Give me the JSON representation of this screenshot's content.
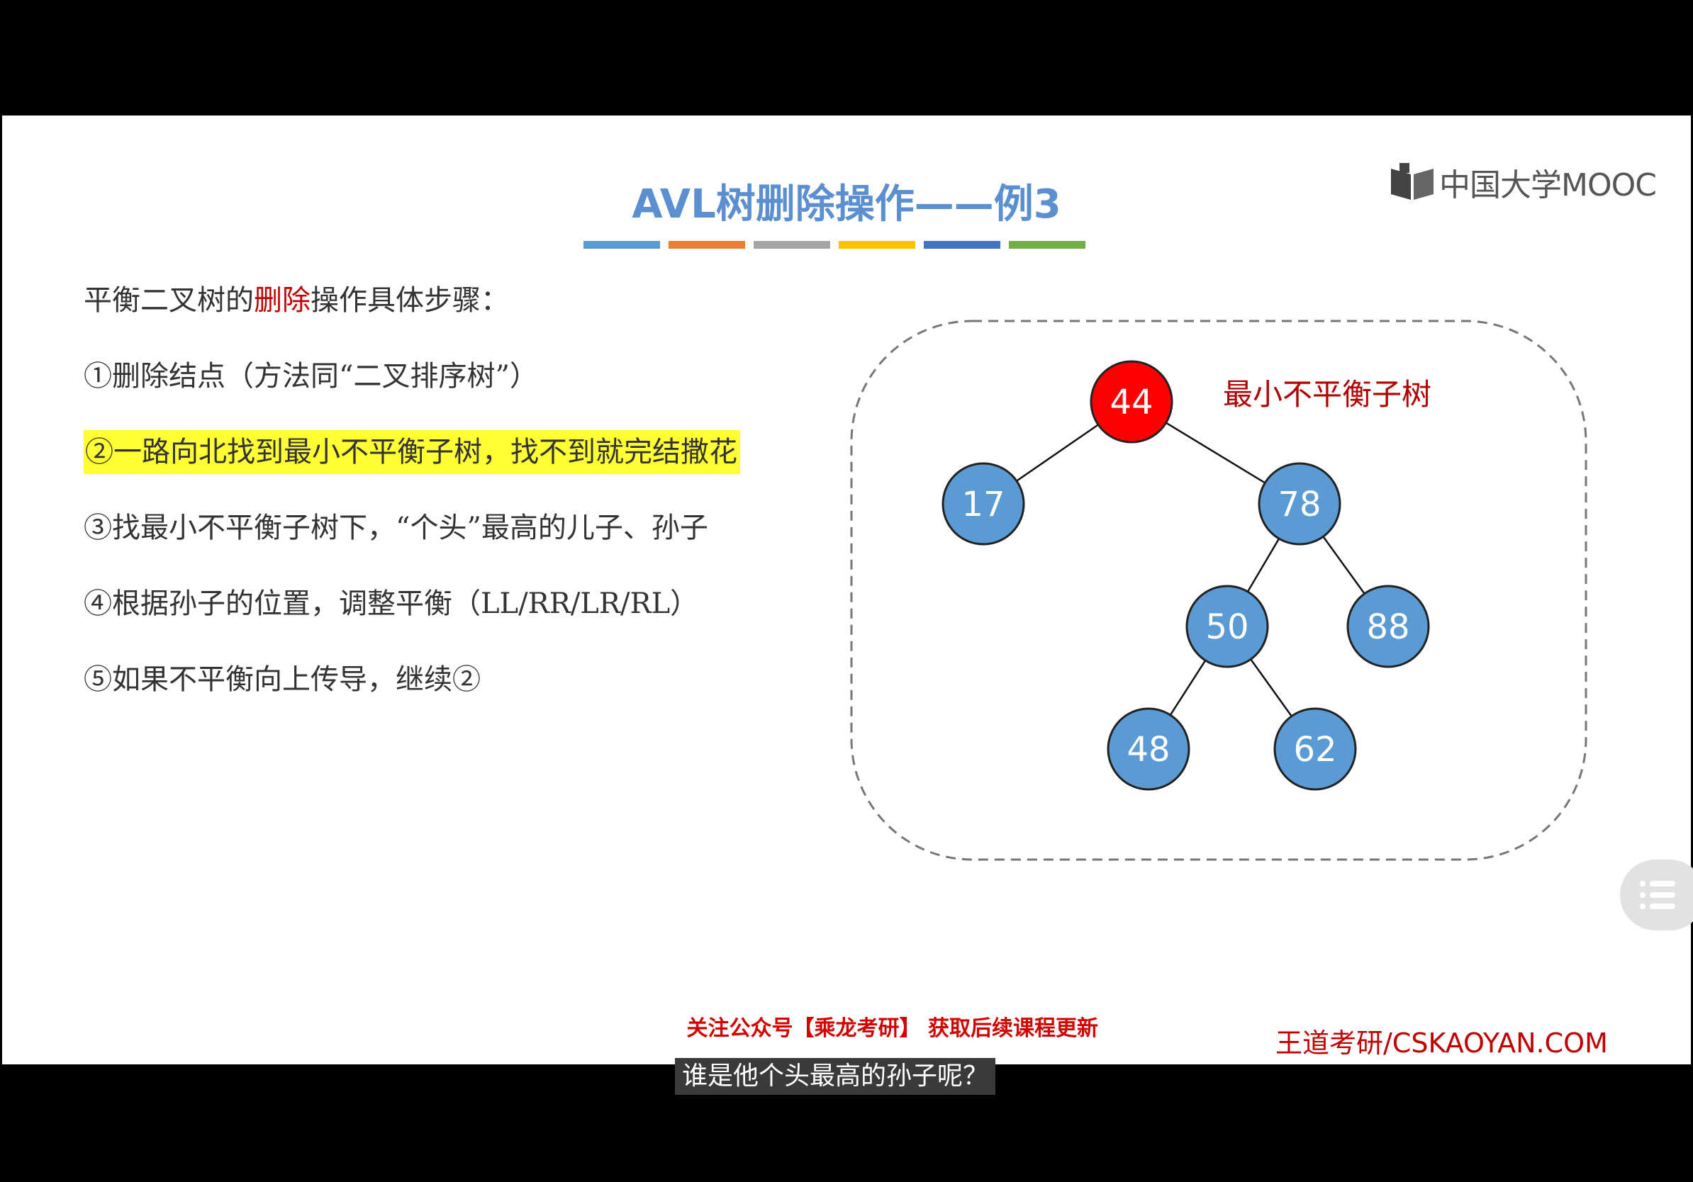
{
  "slide": {
    "logo_text": "中国大学MOOC",
    "title": "AVL树删除操作——例3",
    "title_bar_colors": [
      "#5b9bd5",
      "#ed7d31",
      "#a5a5a5",
      "#ffc000",
      "#4472c4",
      "#70ad47"
    ],
    "intro": {
      "prefix": "平衡二叉树的",
      "emphasis": "删除",
      "suffix": "操作具体步骤："
    },
    "steps": [
      "①删除结点（方法同“二叉排序树”）",
      "②一路向北找到最小不平衡子树，找不到就完结撒花",
      "③找最小不平衡子树下，“个头”最高的儿子、孙子",
      "④根据孙子的位置，调整平衡（LL/RR/LR/RL）",
      "⑤如果不平衡向上传导，继续②"
    ],
    "highlighted_step_index": 1,
    "tree": {
      "label": "最小不平衡子树",
      "node_color": "#5b9bd5",
      "highlight_color": "#ff0000",
      "nodes": [
        {
          "id": "n44",
          "value": "44",
          "highlight": true
        },
        {
          "id": "n17",
          "value": "17",
          "highlight": false
        },
        {
          "id": "n78",
          "value": "78",
          "highlight": false
        },
        {
          "id": "n50",
          "value": "50",
          "highlight": false
        },
        {
          "id": "n88",
          "value": "88",
          "highlight": false
        },
        {
          "id": "n48",
          "value": "48",
          "highlight": false
        },
        {
          "id": "n62",
          "value": "62",
          "highlight": false
        }
      ],
      "edges": [
        [
          "n44",
          "n17"
        ],
        [
          "n44",
          "n78"
        ],
        [
          "n78",
          "n50"
        ],
        [
          "n78",
          "n88"
        ],
        [
          "n50",
          "n48"
        ],
        [
          "n50",
          "n62"
        ]
      ]
    },
    "footer_notice": "关注公众号【乘龙考研】 获取后续课程更新",
    "footer_brand": "王道考研/CSKAOYAN.COM"
  },
  "subtitle": "谁是他个头最高的孙子呢？",
  "menu_button_icon": "list-menu-icon"
}
